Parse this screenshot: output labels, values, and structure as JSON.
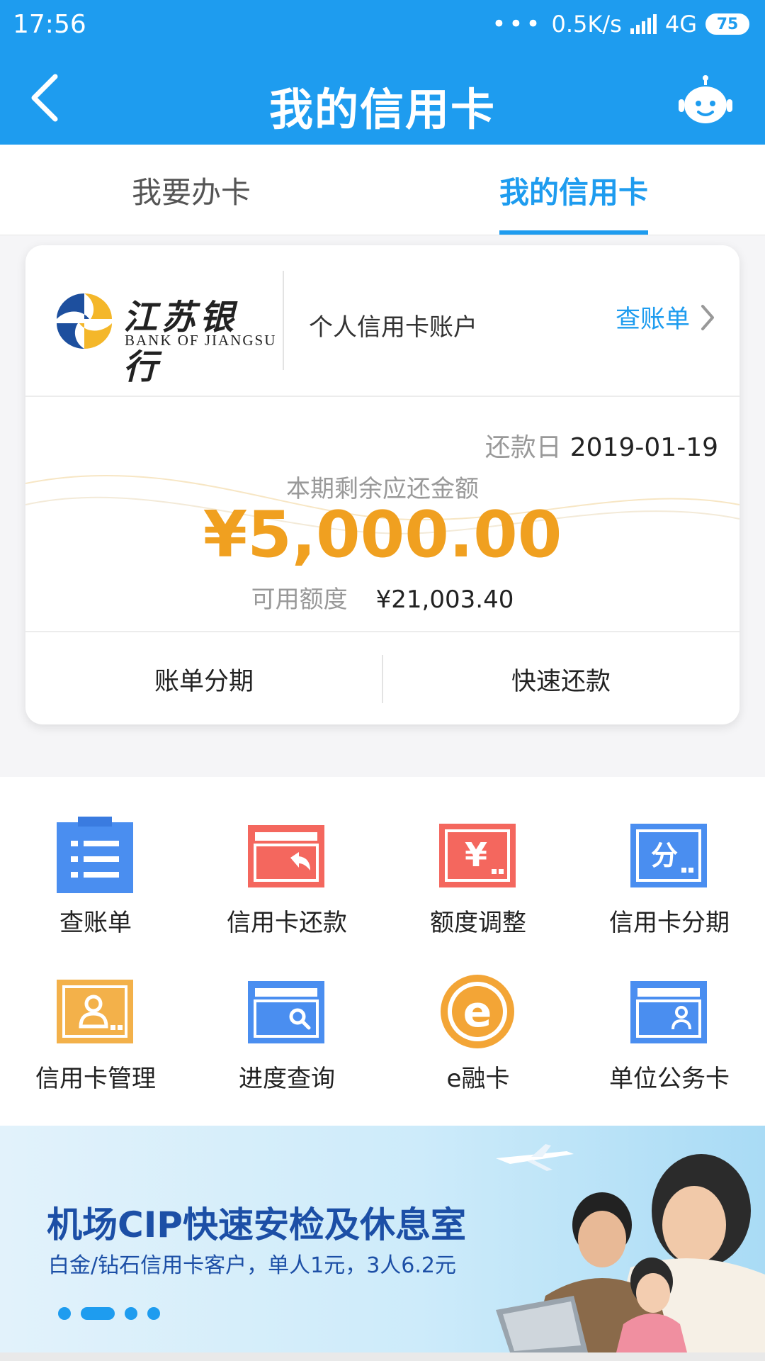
{
  "status_bar": {
    "time": "17:56",
    "dots": "•••",
    "network_speed": "0.5K/s",
    "network_type": "4G",
    "battery": "75"
  },
  "header": {
    "title": "我的信用卡",
    "back_icon": "chevron-left-icon",
    "assistant_icon": "robot-icon"
  },
  "tabs": [
    {
      "label": "我要办卡",
      "active": false
    },
    {
      "label": "我的信用卡",
      "active": true
    }
  ],
  "card": {
    "bank_name_cn": "江苏银行",
    "bank_name_en": "BANK OF JIANGSU",
    "account_label": "个人信用卡账户",
    "view_bill_label": "查账单",
    "due_label": "还款日",
    "due_date": "2019-01-19",
    "remaining_label": "本期剩余应还金额",
    "remaining_amount": "¥5,000.00",
    "available_label": "可用额度",
    "available_amount": "¥21,003.40",
    "actions": [
      "账单分期",
      "快速还款"
    ]
  },
  "services": [
    {
      "label": "查账单",
      "icon": "bill-list-icon"
    },
    {
      "label": "信用卡还款",
      "icon": "card-repay-icon"
    },
    {
      "label": "额度调整",
      "icon": "limit-adjust-icon"
    },
    {
      "label": "信用卡分期",
      "icon": "installment-icon"
    },
    {
      "label": "信用卡管理",
      "icon": "card-manage-icon"
    },
    {
      "label": "进度查询",
      "icon": "progress-search-icon"
    },
    {
      "label": "e融卡",
      "icon": "e-card-icon"
    },
    {
      "label": "单位公务卡",
      "icon": "corporate-card-icon"
    }
  ],
  "banner": {
    "title": "机场CIP快速安检及休息室",
    "subtitle": "白金/钻石信用卡客户，单人1元，3人6.2元",
    "pages": 4,
    "active_page": 2
  },
  "colors": {
    "primary": "#1e9cef",
    "amount": "#f0a020",
    "banner_text": "#1c4fa6"
  }
}
